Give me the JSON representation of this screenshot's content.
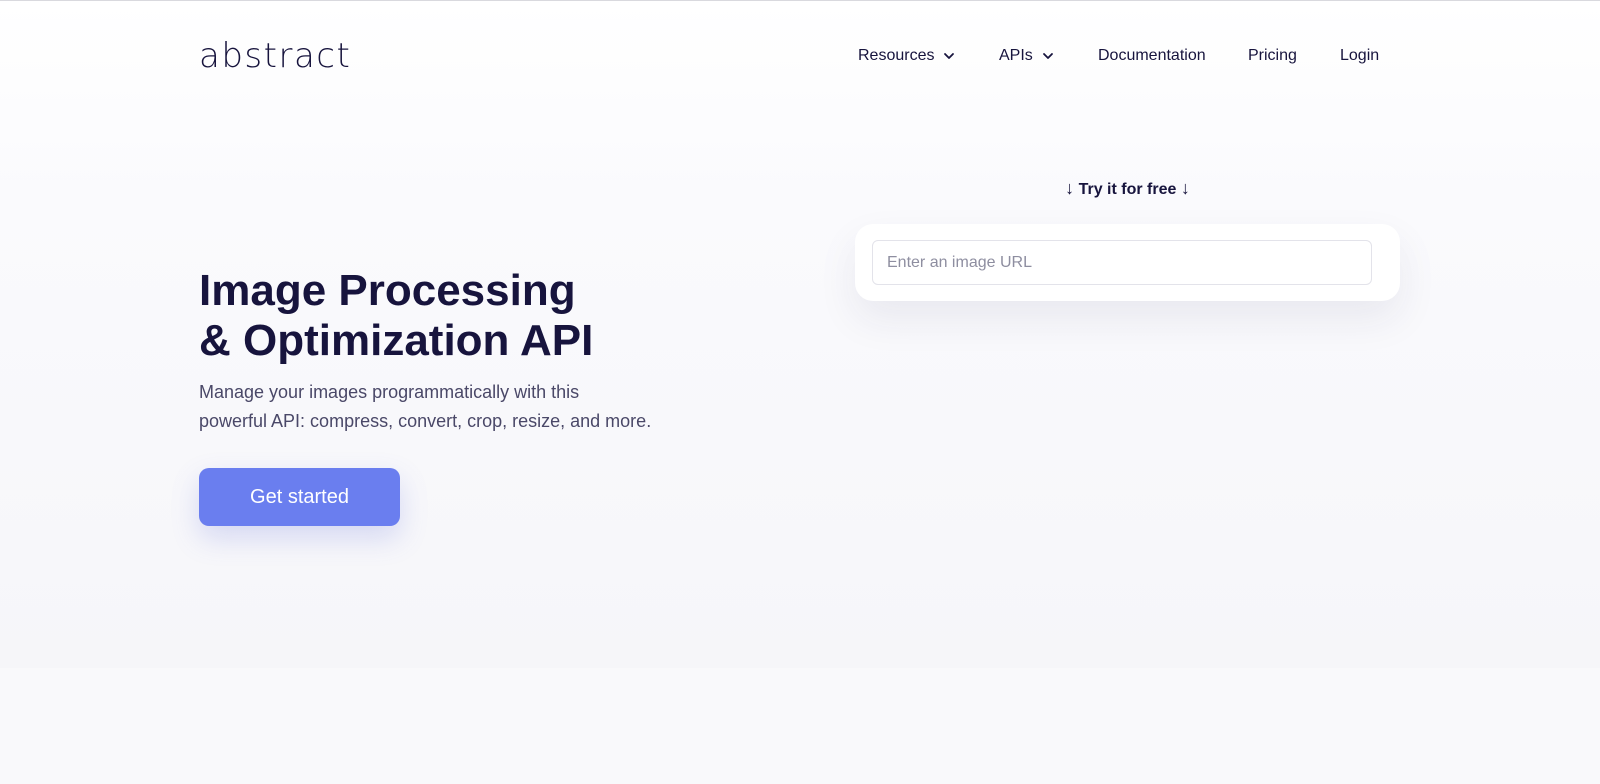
{
  "header": {
    "logo": "abstract",
    "nav": [
      {
        "label": "Resources",
        "has_dropdown": true
      },
      {
        "label": "APIs",
        "has_dropdown": true
      },
      {
        "label": "Documentation",
        "has_dropdown": false
      },
      {
        "label": "Pricing",
        "has_dropdown": false
      },
      {
        "label": "Login",
        "has_dropdown": false
      }
    ]
  },
  "hero": {
    "title_line1": "Image Processing",
    "title_line2": "& Optimization API",
    "subtitle_line1": "Manage your images programmatically with this",
    "subtitle_line2": "powerful API: compress, convert, crop, resize, and more.",
    "cta_label": "Get started"
  },
  "try_it": {
    "arrow": "↓",
    "label": "Try it for free",
    "input_placeholder": "Enter an image URL",
    "input_value": ""
  },
  "colors": {
    "text_dark": "#17143d",
    "accent": "#6a7eef",
    "subtext": "#4a4868"
  }
}
